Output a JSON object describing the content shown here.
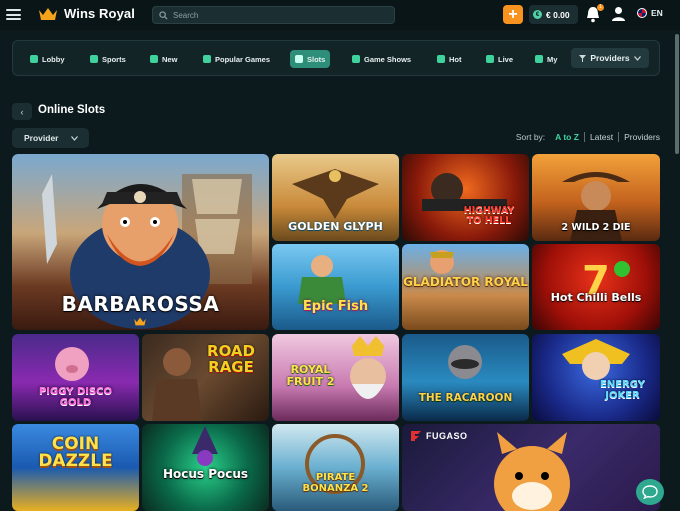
{
  "header": {
    "brand": "Wins Royal",
    "search_placeholder": "Search",
    "plus_label": "+",
    "balance": "€ 0.00",
    "notification_count": "1",
    "language": "EN"
  },
  "nav": {
    "items": [
      {
        "label": "Lobby"
      },
      {
        "label": "Sports"
      },
      {
        "label": "New"
      },
      {
        "label": "Popular Games"
      },
      {
        "label": "Slots"
      },
      {
        "label": "Game Shows"
      },
      {
        "label": "Hot"
      },
      {
        "label": "Live"
      },
      {
        "label": "My"
      }
    ],
    "active": "Slots",
    "providers_label": "Providers"
  },
  "section": {
    "title": "Online Slots",
    "provider_dropdown": "Provider",
    "sort_label": "Sort by:",
    "sort_options": [
      "A to Z",
      "Latest",
      "Providers"
    ],
    "sort_active": "A to Z"
  },
  "games": [
    {
      "name": "BARBAROSSA"
    },
    {
      "name": "GOLDEN GLYPH"
    },
    {
      "name": "HIGHWAY TO HELL"
    },
    {
      "name": "2 WILD 2 DIE"
    },
    {
      "name": "Epic Fish"
    },
    {
      "name": "GLADIATOR ROYAL"
    },
    {
      "name": "Hot Chilli Bells"
    },
    {
      "name": "PIGGY DISCO GOLD"
    },
    {
      "name": "ROAD RAGE"
    },
    {
      "name": "ROYAL FRUIT 2"
    },
    {
      "name": "THE RACAROON"
    },
    {
      "name": "ENERGY JOKER"
    },
    {
      "name": "COIN DAZZLE"
    },
    {
      "name": "Hocus Pocus"
    },
    {
      "name": "PIRATE BONANZA 2"
    },
    {
      "name": "FUGASO"
    }
  ],
  "colors": {
    "background": "#0c1a1d",
    "accent": "#3fd29c",
    "active_nav": "#2d8f7a",
    "orange": "#f7931e"
  }
}
